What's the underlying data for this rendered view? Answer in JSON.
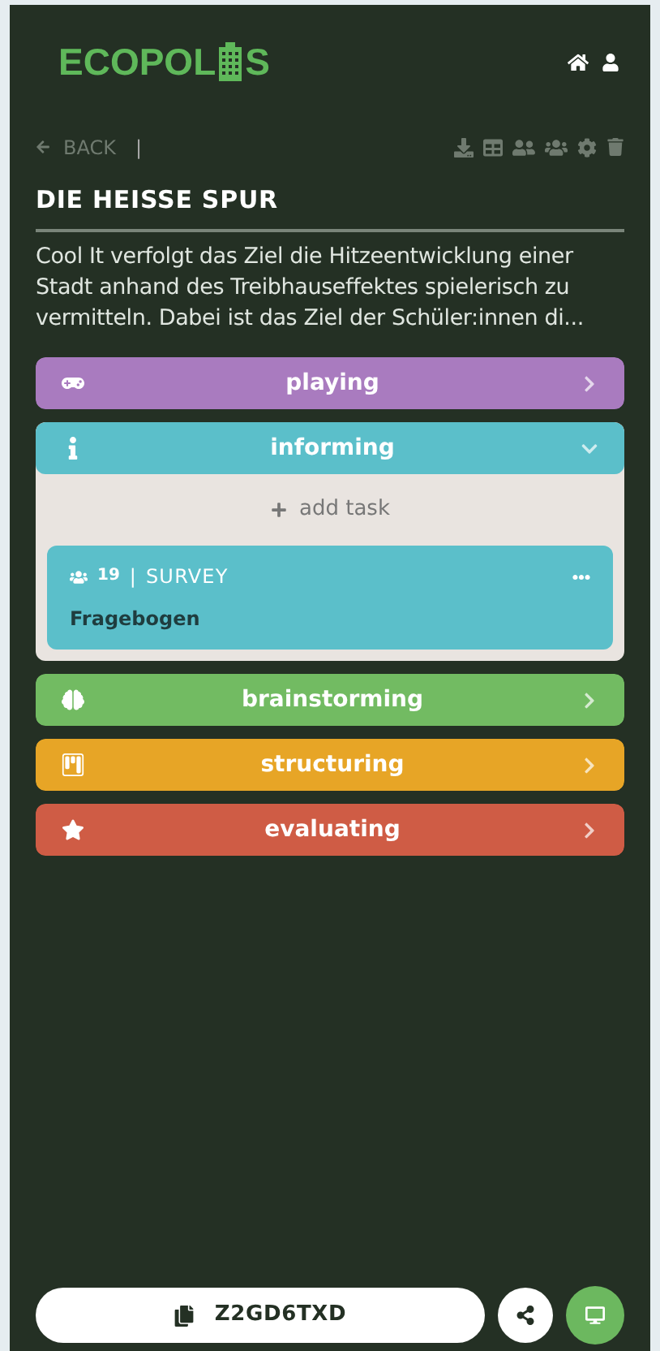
{
  "logo": {
    "before": "ECOPOL",
    "after": "S"
  },
  "toolbar": {
    "back": "BACK",
    "separator": "|"
  },
  "title": "DIE HEISSE SPUR",
  "description": "Cool It verfolgt das Ziel die Hitzeentwicklung einer Stadt anhand des Treibhauseffektes spielerisch zu vermitteln. Dabei ist das Ziel der Schüler:innen di...",
  "phases": [
    {
      "kind": "gamepad",
      "label": "playing",
      "color": "#a97bbf",
      "expanded": false
    },
    {
      "kind": "info",
      "label": "informing",
      "color": "#5bbfca",
      "expanded": true,
      "add_task": "add task",
      "tasks": [
        {
          "count": "19",
          "separator": "|",
          "type": "SURVEY",
          "name": "Fragebogen"
        }
      ]
    },
    {
      "kind": "brain",
      "label": "brainstorming",
      "color": "#72bb62",
      "expanded": false
    },
    {
      "kind": "board",
      "label": "structuring",
      "color": "#e7a526",
      "expanded": false
    },
    {
      "kind": "star",
      "label": "evaluating",
      "color": "#cf5c45",
      "expanded": false
    }
  ],
  "footer": {
    "code": "Z2GD6TXD"
  }
}
